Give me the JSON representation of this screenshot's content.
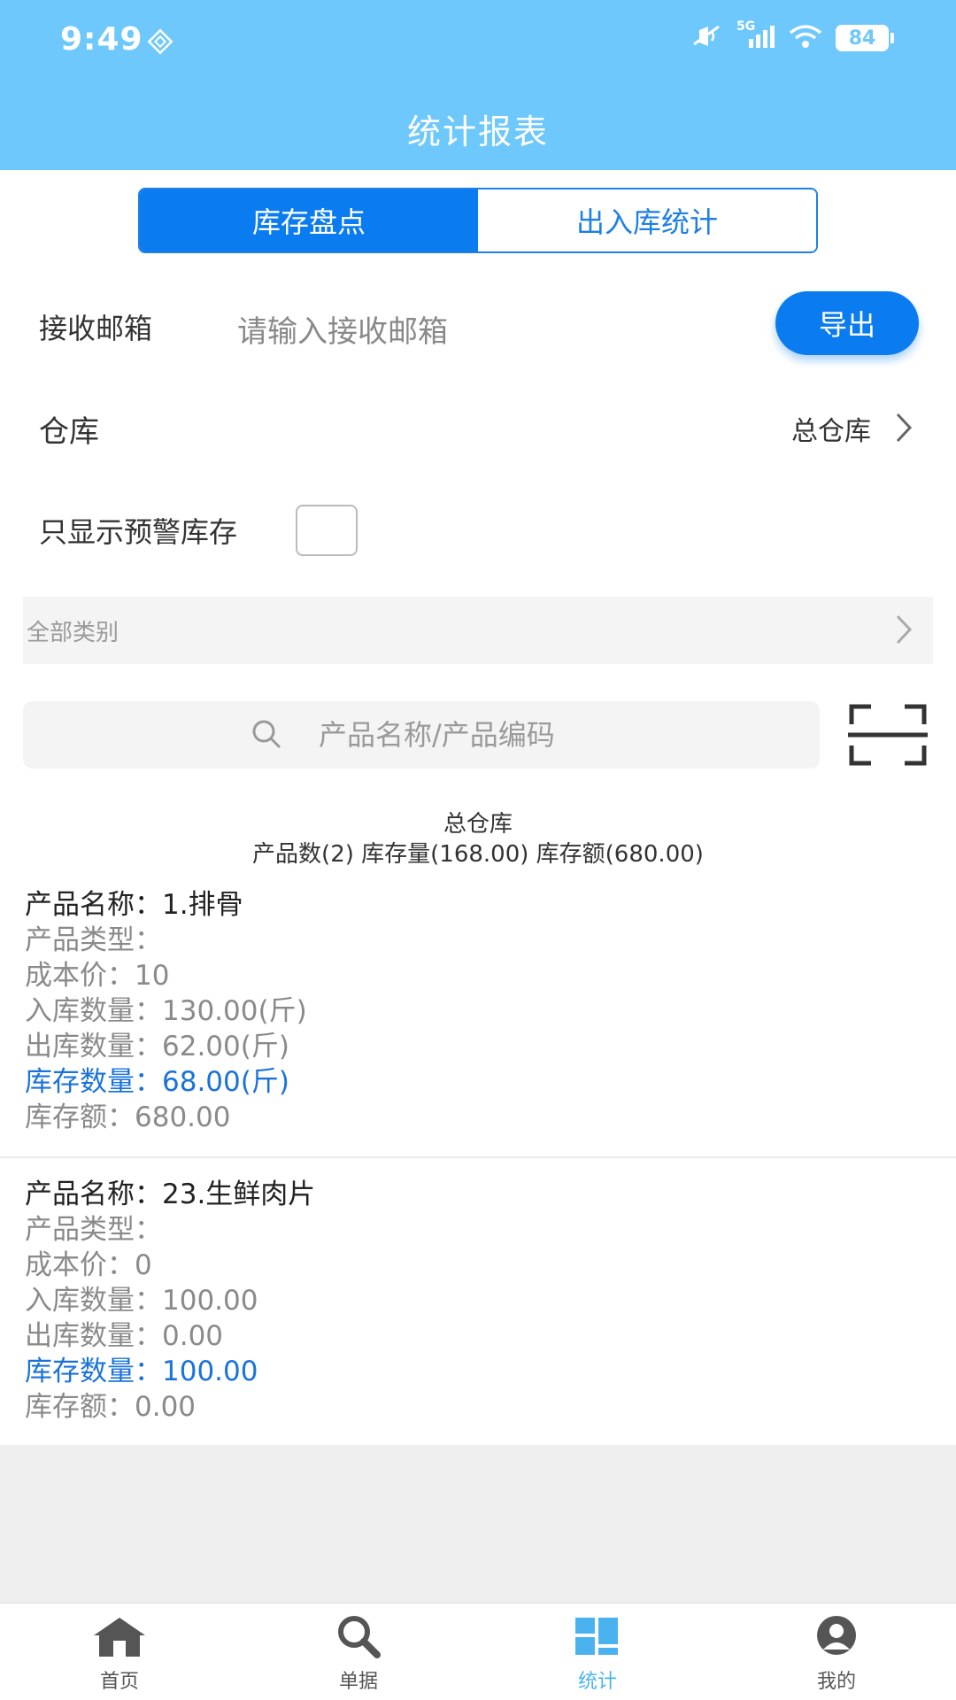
{
  "status_bar": {
    "time": "9:49",
    "battery": "84",
    "network": "5G"
  },
  "header": {
    "title": "统计报表"
  },
  "tabs": [
    {
      "label": "库存盘点",
      "active": true
    },
    {
      "label": "出入库统计",
      "active": false
    }
  ],
  "email": {
    "label": "接收邮箱",
    "placeholder": "请输入接收邮箱",
    "value": "",
    "export_label": "导出"
  },
  "warehouse": {
    "label": "仓库",
    "value": "总仓库"
  },
  "warning_filter": {
    "label": "只显示预警库存",
    "checked": false
  },
  "category": {
    "label": "全部类别"
  },
  "search": {
    "placeholder": "产品名称/产品编码",
    "value": ""
  },
  "summary": {
    "warehouse": "总仓库",
    "stats": "产品数(2) 库存量(168.00) 库存额(680.00)"
  },
  "products": [
    {
      "name": "产品名称：1.排骨",
      "type": "产品类型：",
      "cost": "成本价：10",
      "inbound": "入库数量：130.00(斤)",
      "outbound": "出库数量：62.00(斤)",
      "stock": "库存数量：68.00(斤)",
      "amount": "库存额：680.00"
    },
    {
      "name": "产品名称：23.生鲜肉片",
      "type": "产品类型：",
      "cost": "成本价：0",
      "inbound": "入库数量：100.00",
      "outbound": "出库数量：0.00",
      "stock": "库存数量：100.00",
      "amount": "库存额：0.00"
    }
  ],
  "bottom_nav": [
    {
      "label": "首页",
      "icon": "home-icon",
      "active": false
    },
    {
      "label": "单据",
      "icon": "search-icon",
      "active": false
    },
    {
      "label": "统计",
      "icon": "stats-icon",
      "active": true
    },
    {
      "label": "我的",
      "icon": "user-icon",
      "active": false
    }
  ],
  "colors": {
    "header_bg": "#6ec8fb",
    "accent": "#0b7cf0",
    "stock_text": "#1a73d9",
    "nav_active": "#4ab3ef"
  }
}
